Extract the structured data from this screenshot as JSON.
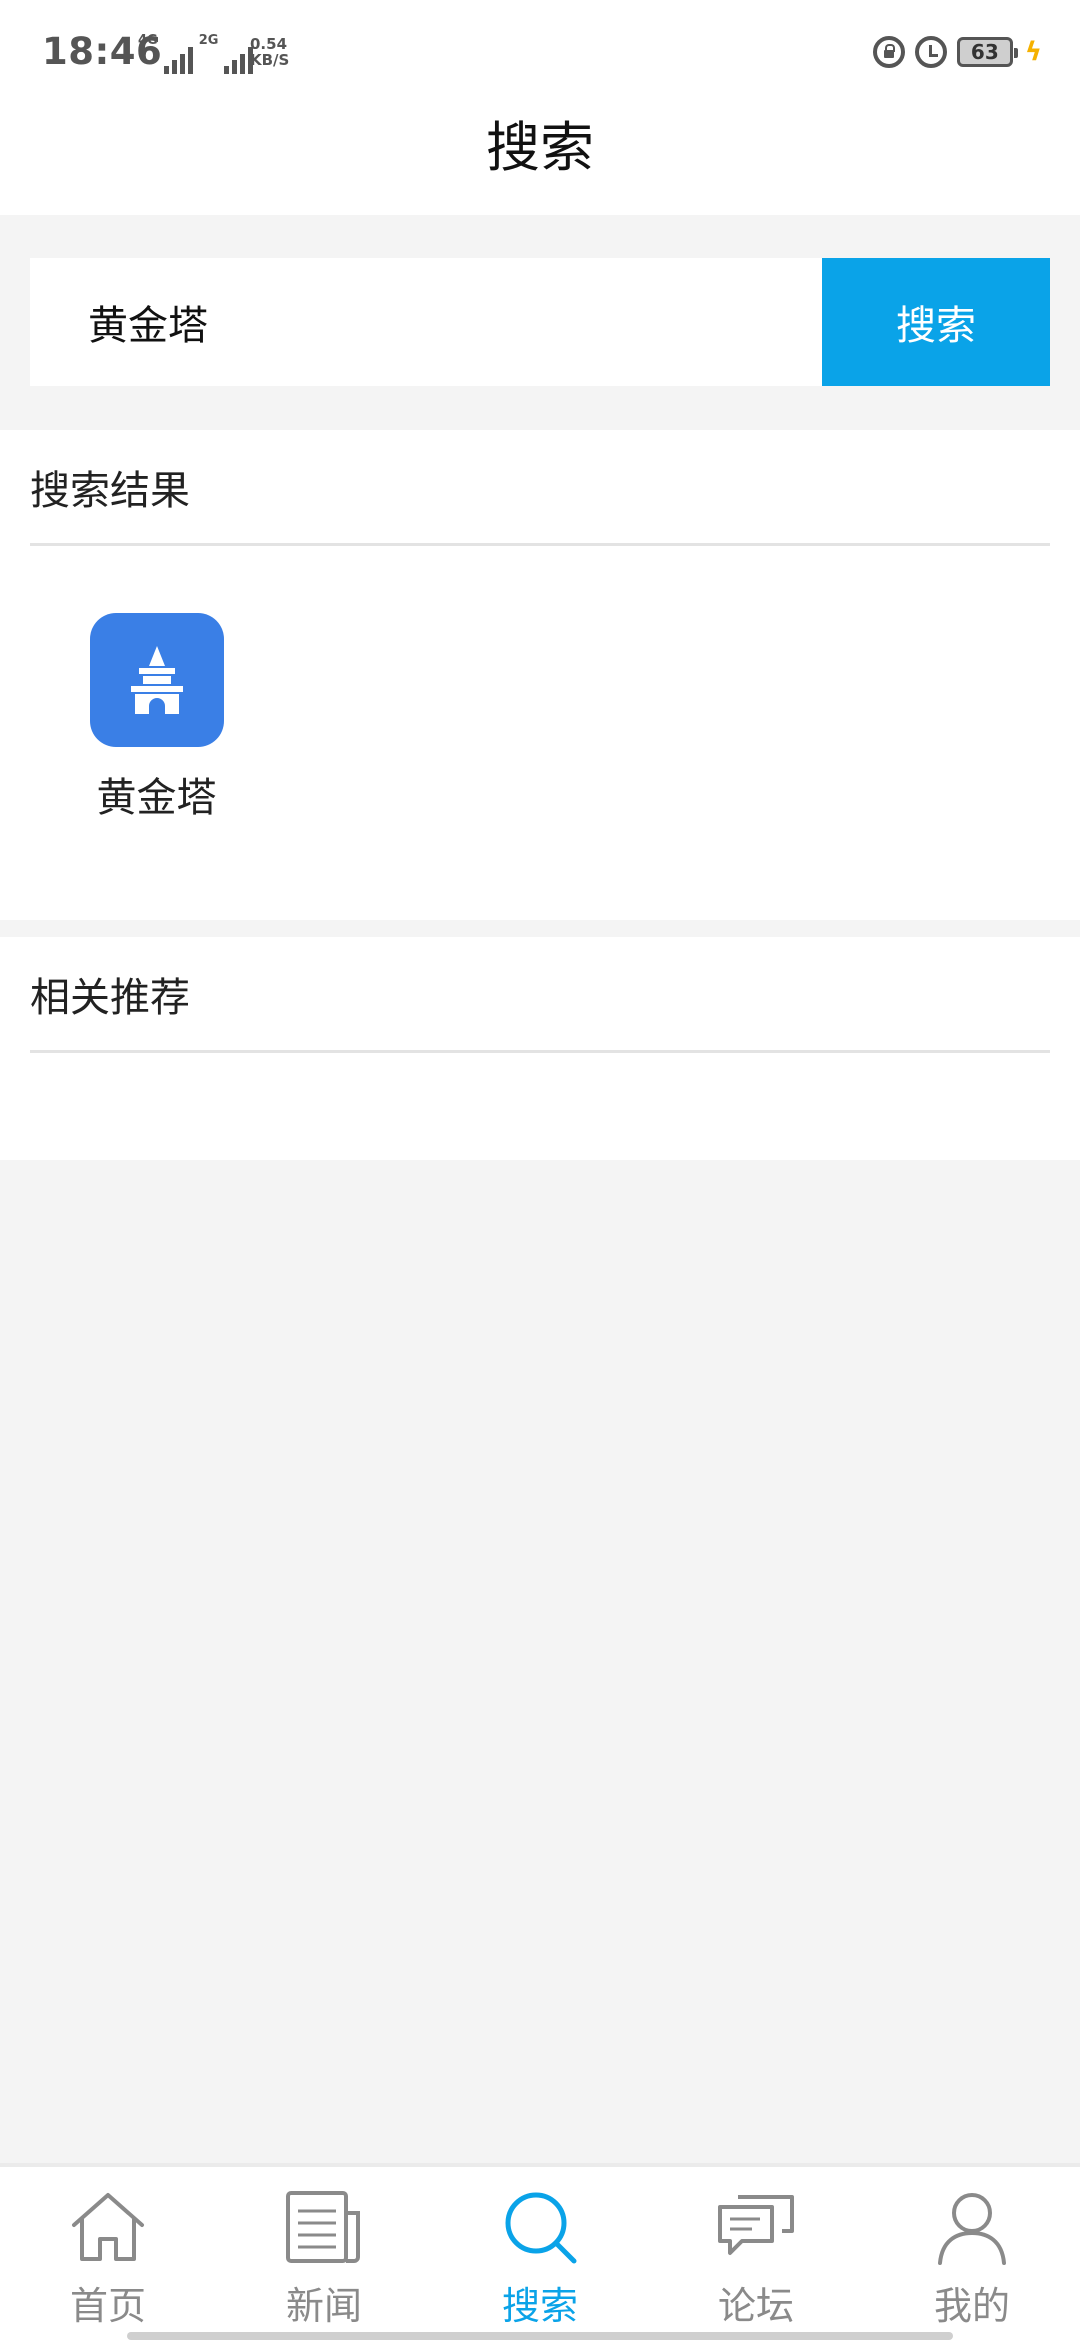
{
  "status_bar": {
    "time": "18:46",
    "network1_label": "4G",
    "network2_label": "2G",
    "speed_value": "0.54",
    "speed_unit": "KB/S",
    "battery": "63"
  },
  "header": {
    "title": "搜索"
  },
  "search": {
    "query": "黄金塔",
    "button_label": "搜索"
  },
  "results": {
    "title": "搜索结果",
    "items": [
      {
        "label": "黄金塔",
        "icon": "pagoda-icon"
      }
    ]
  },
  "related": {
    "title": "相关推荐"
  },
  "bottom_nav": {
    "items": [
      {
        "label": "首页",
        "icon": "home-icon"
      },
      {
        "label": "新闻",
        "icon": "news-icon"
      },
      {
        "label": "搜索",
        "icon": "search-icon",
        "active": true
      },
      {
        "label": "论坛",
        "icon": "forum-icon"
      },
      {
        "label": "我的",
        "icon": "profile-icon"
      }
    ]
  },
  "colors": {
    "accent": "#0aa3e8",
    "app_icon_bg": "#3a7fe6",
    "page_bg": "#f4f4f4"
  }
}
